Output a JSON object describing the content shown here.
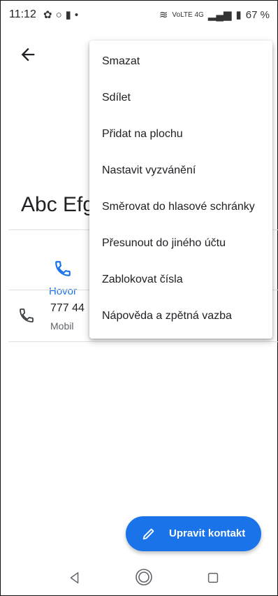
{
  "status_bar": {
    "time": "11:12",
    "left_icons": [
      "settings-icon",
      "circle-icon",
      "sim-icon",
      "dot"
    ],
    "signal_text": "VoLTE 4G",
    "battery": "67 %"
  },
  "contact": {
    "name": "Abc Efg",
    "call_action_label": "Hovor",
    "phone_number": "777 44",
    "phone_type": "Mobil"
  },
  "menu": {
    "items": [
      "Smazat",
      "Sdílet",
      "Přidat na plochu",
      "Nastavit vyzvánění",
      "Směrovat do hlasové schránky",
      "Přesunout do jiného účtu",
      "Zablokovat čísla",
      "Nápověda a zpětná vazba"
    ]
  },
  "fab": {
    "label": "Upravit kontakt"
  },
  "colors": {
    "accent": "#1a73e8"
  }
}
